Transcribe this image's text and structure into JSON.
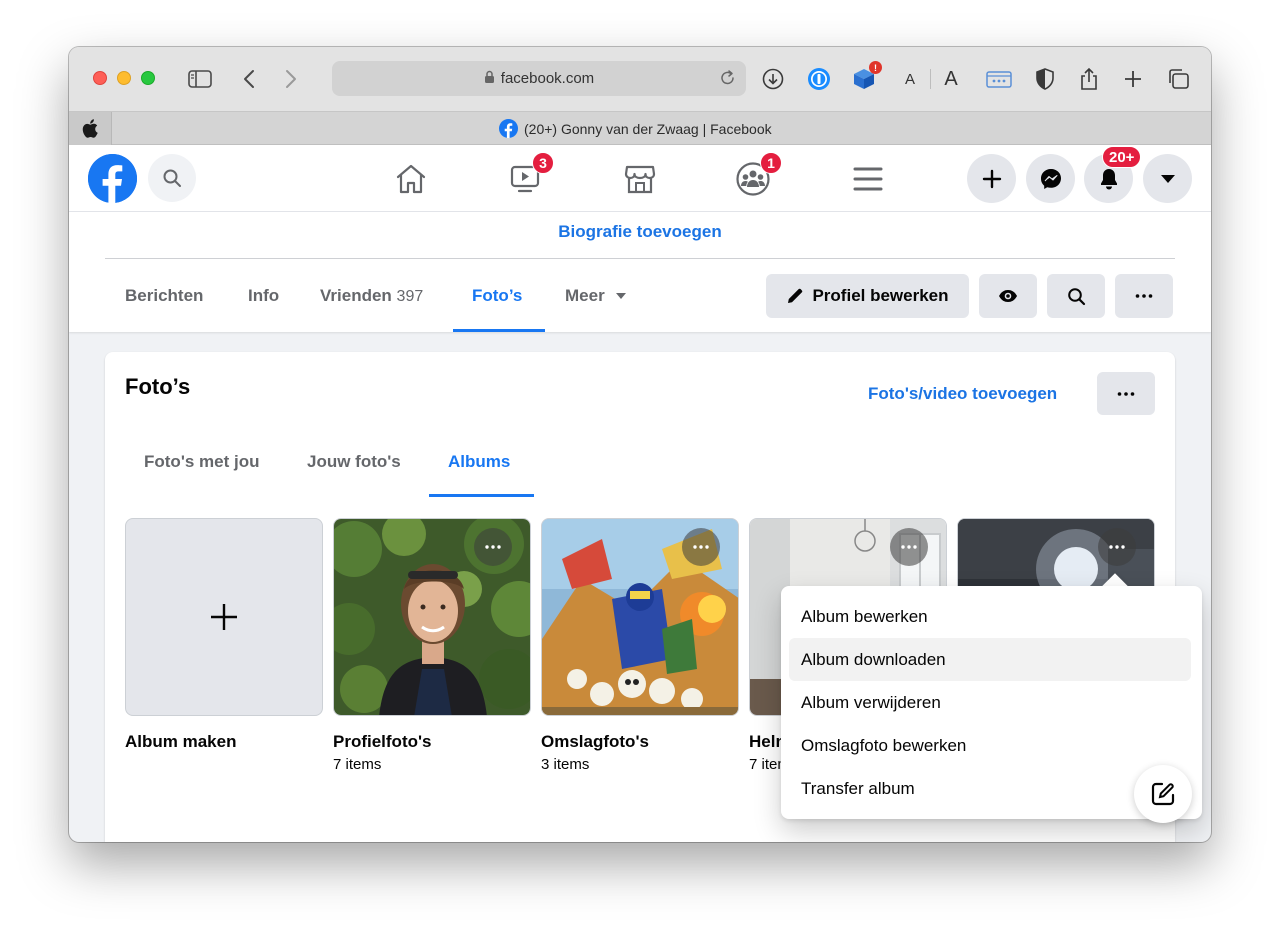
{
  "browser": {
    "url": "facebook.com",
    "tab_title": "(20+) Gonny van der Zwaag | Facebook",
    "ext_badge": "!",
    "text_size_small": "A",
    "text_size_large": "A"
  },
  "fbnav": {
    "watch_badge": "3",
    "groups_badge": "1",
    "notifications_badge": "20+"
  },
  "profile": {
    "bio_link": "Biografie toevoegen",
    "tabs": [
      {
        "label": "Berichten"
      },
      {
        "label": "Info"
      },
      {
        "label": "Vrienden",
        "count": "397"
      },
      {
        "label": "Foto’s"
      },
      {
        "label": "Meer"
      }
    ],
    "edit_profile": "Profiel bewerken"
  },
  "photos": {
    "title": "Foto’s",
    "add_link": "Foto's/video toevoegen",
    "subtabs": [
      "Foto's met jou",
      "Jouw foto's",
      "Albums"
    ],
    "albums": [
      {
        "name": "Album maken",
        "count": ""
      },
      {
        "name": "Profielfoto's",
        "count": "7 items"
      },
      {
        "name": "Omslagfoto's",
        "count": "3 items"
      },
      {
        "name": "Helmond",
        "count": "7 items"
      },
      {
        "name": "",
        "count": ""
      }
    ]
  },
  "menu": {
    "items": [
      "Album bewerken",
      "Album downloaden",
      "Album verwijderen",
      "Omslagfoto bewerken",
      "Transfer album"
    ]
  },
  "colors": {
    "brand": "#1877f2",
    "link": "#1b74e4",
    "badge": "#e41e3f"
  }
}
